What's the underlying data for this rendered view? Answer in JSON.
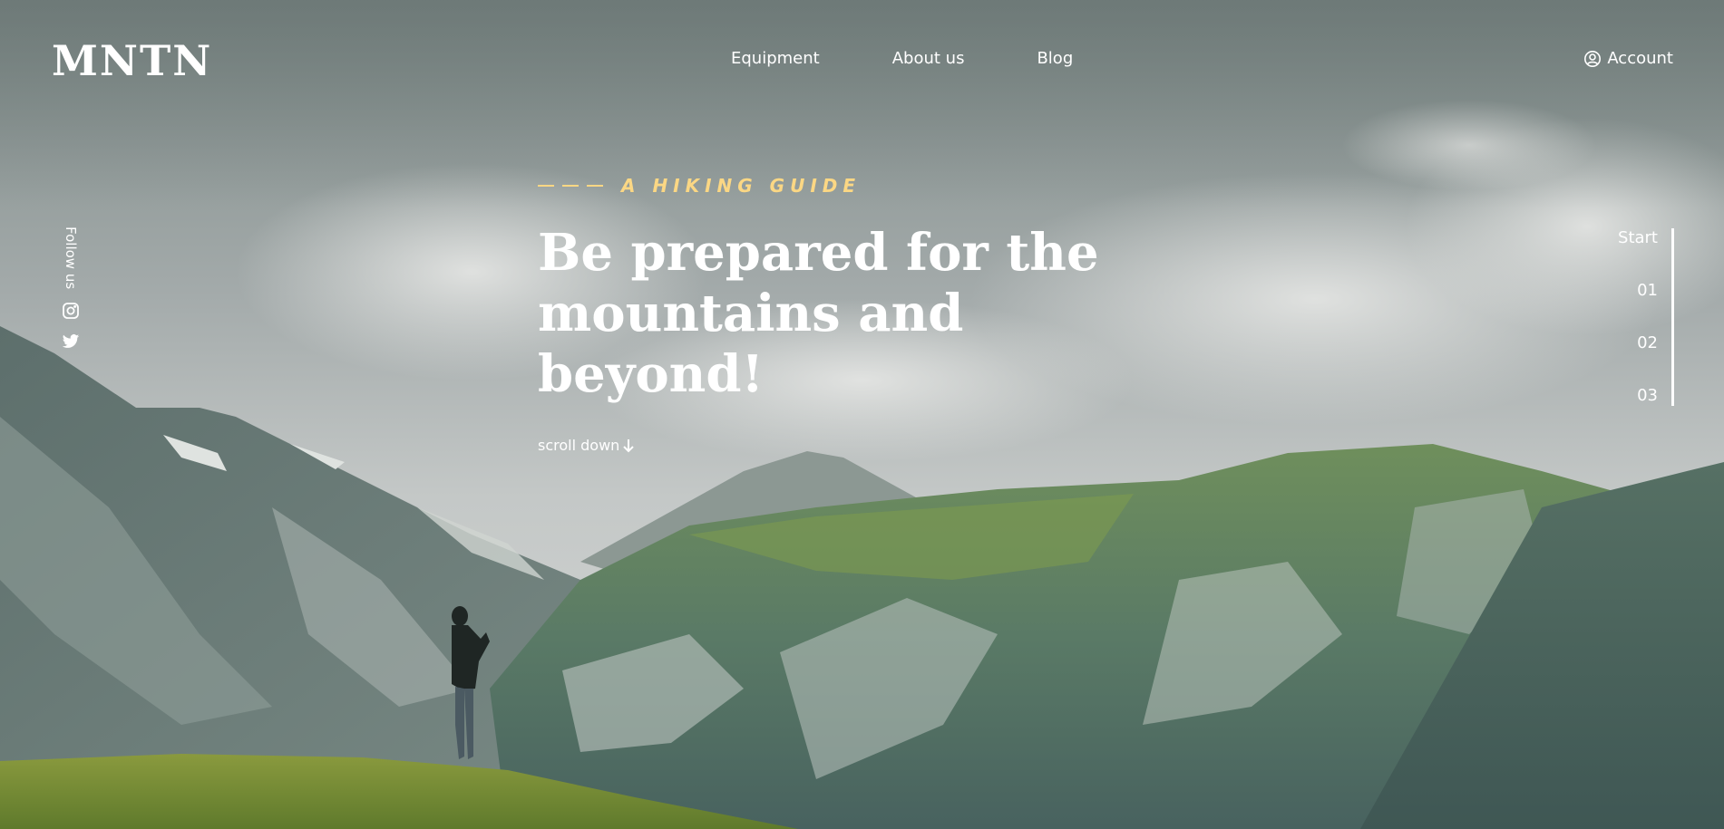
{
  "header": {
    "logo": "MNTN",
    "nav": [
      "Equipment",
      "About us",
      "Blog"
    ],
    "account_label": "Account",
    "account_icon": "user-circle-icon"
  },
  "social": {
    "label": "Follow us",
    "icons": [
      "instagram-icon",
      "twitter-icon"
    ]
  },
  "hero": {
    "eyebrow": "A HIKING GUIDE",
    "headline_line1": "Be prepared for the",
    "headline_line2": "mountains and beyond!",
    "scroll_label": "scroll down",
    "scroll_icon": "arrow-down-icon"
  },
  "pager": {
    "items": [
      "Start",
      "01",
      "02",
      "03"
    ]
  },
  "colors": {
    "accent": "#fbd784",
    "text": "#ffffff"
  }
}
